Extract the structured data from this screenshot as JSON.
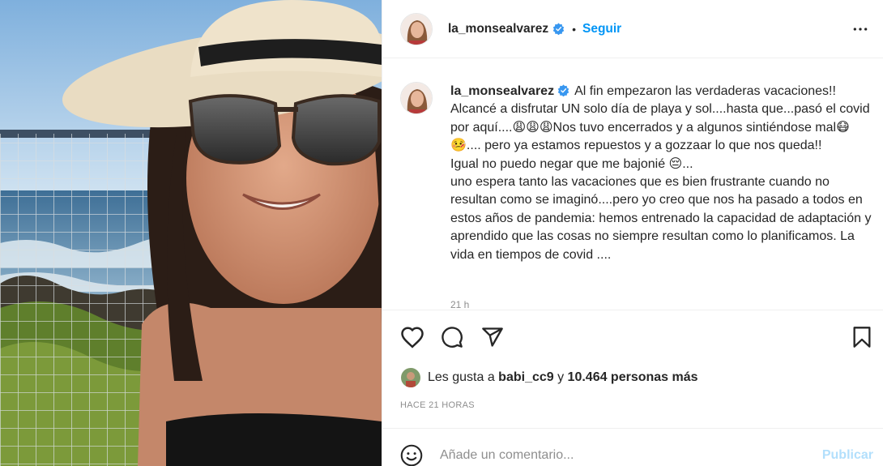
{
  "post": {
    "username": "la_monsealvarez",
    "verified": true,
    "separator": "•",
    "follow_label": "Seguir",
    "more_icon": "more-horizontal-icon"
  },
  "caption": {
    "username": "la_monsealvarez",
    "text": "Al fin empezaron las verdaderas vacaciones!! Alcancé a disfrutar UN solo día de playa y sol....hasta que...pasó el covid por aquí....😩😩😩Nos tuvo encerrados y a algunos sintiéndose mal😷🤒.... pero ya estamos repuestos y a gozzaar lo que nos queda!!\nIgual no puedo negar que me bajonié 😔...\nuno espera tanto las vacaciones que es bien frustrante cuando no resultan como se imaginó....pero yo creo que nos ha pasado a todos en estos años de pandemia: hemos entrenado la capacidad de adaptación y aprendido que las cosas no siempre resultan como lo planificamos. La vida en tiempos de covid ....",
    "time_short": "21 h"
  },
  "actions": {
    "like_icon": "heart-icon",
    "comment_icon": "comment-icon",
    "share_icon": "paper-plane-icon",
    "save_icon": "bookmark-icon"
  },
  "likes": {
    "prefix": "Les gusta a ",
    "first_user": "babi_cc9",
    "connector": " y ",
    "others": "10.464 personas más"
  },
  "timestamp": "HACE 21 HORAS",
  "comment": {
    "placeholder": "Añade un comentario...",
    "publish_label": "Publicar",
    "emoji_icon": "smiley-icon"
  },
  "colors": {
    "accent": "#0095f6",
    "publish_disabled": "#b2dffc",
    "text": "#262626",
    "muted": "#8e8e8e",
    "border": "#efefef"
  }
}
